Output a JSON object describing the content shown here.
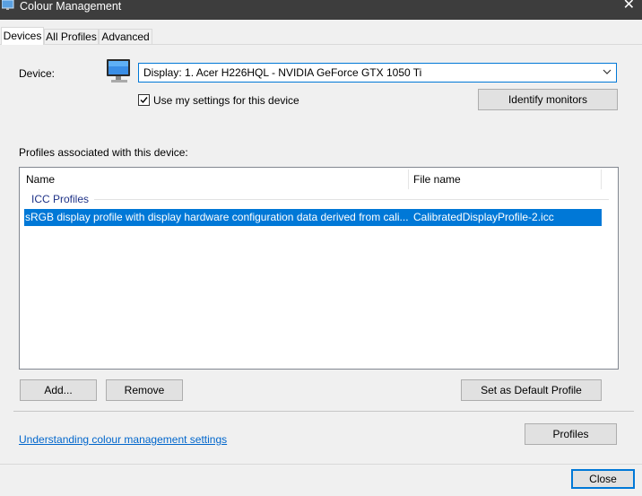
{
  "window": {
    "title": "Colour Management",
    "close_glyph": "✕"
  },
  "tabs": [
    {
      "label": "Devices",
      "active": true
    },
    {
      "label": "All Profiles",
      "active": false
    },
    {
      "label": "Advanced",
      "active": false
    }
  ],
  "device": {
    "label": "Device:",
    "selected": "Display: 1. Acer H226HQL - NVIDIA GeForce GTX 1050 Ti",
    "use_my_settings_label": "Use my settings for this device",
    "use_my_settings_checked": true,
    "identify_button": "Identify monitors"
  },
  "profiles": {
    "section_label": "Profiles associated with this device:",
    "columns": [
      "Name",
      "File name"
    ],
    "group": "ICC Profiles",
    "rows": [
      {
        "name": "sRGB display profile with display hardware configuration data derived from cali...",
        "file": "CalibratedDisplayProfile-2.icc",
        "selected": true
      }
    ]
  },
  "buttons": {
    "add": "Add...",
    "remove": "Remove",
    "set_default": "Set as Default Profile",
    "profiles": "Profiles",
    "close": "Close"
  },
  "link": {
    "text": "Understanding colour management settings"
  },
  "colors": {
    "accent": "#0078d7",
    "titlebar": "#3d3d3d",
    "group_text": "#1e3287",
    "link": "#0066cc"
  },
  "icons": [
    "colour-management-app-icon",
    "close-icon",
    "monitor-icon",
    "chevron-down-icon",
    "checkmark-icon"
  ]
}
